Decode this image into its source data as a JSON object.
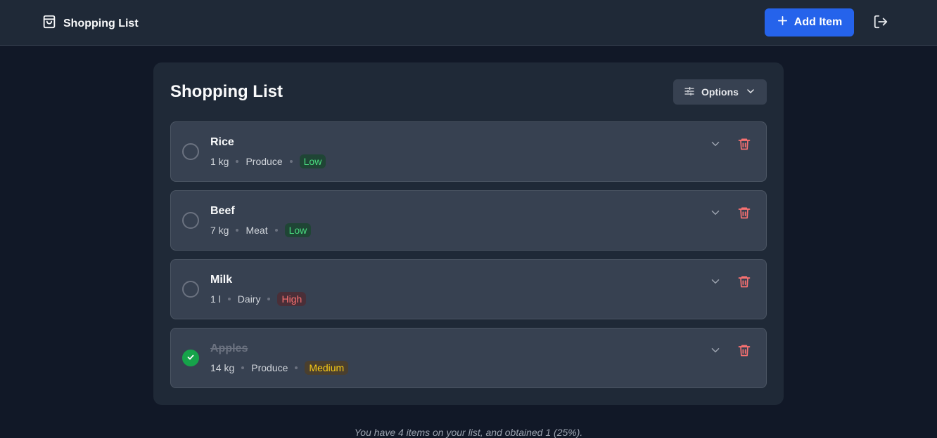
{
  "header": {
    "brand_title": "Shopping List",
    "brand_icon": "shopping-bag-icon",
    "add_button_label": "Add Item",
    "logout_icon": "logout-icon"
  },
  "list": {
    "title": "Shopping List",
    "options_label": "Options",
    "items": [
      {
        "name": "Rice",
        "quantity": "1 kg",
        "category": "Produce",
        "priority": "Low",
        "obtained": false
      },
      {
        "name": "Beef",
        "quantity": "7 kg",
        "category": "Meat",
        "priority": "Low",
        "obtained": false
      },
      {
        "name": "Milk",
        "quantity": "1 l",
        "category": "Dairy",
        "priority": "High",
        "obtained": false
      },
      {
        "name": "Apples",
        "quantity": "14 kg",
        "category": "Produce",
        "priority": "Medium",
        "obtained": true
      }
    ]
  },
  "footer": {
    "summary": "You have 4 items on your list, and obtained 1 (25%)."
  },
  "colors": {
    "accent": "#2563eb",
    "low": "#4ade80",
    "high": "#f87171",
    "medium": "#facc15",
    "done": "#16a34a"
  }
}
